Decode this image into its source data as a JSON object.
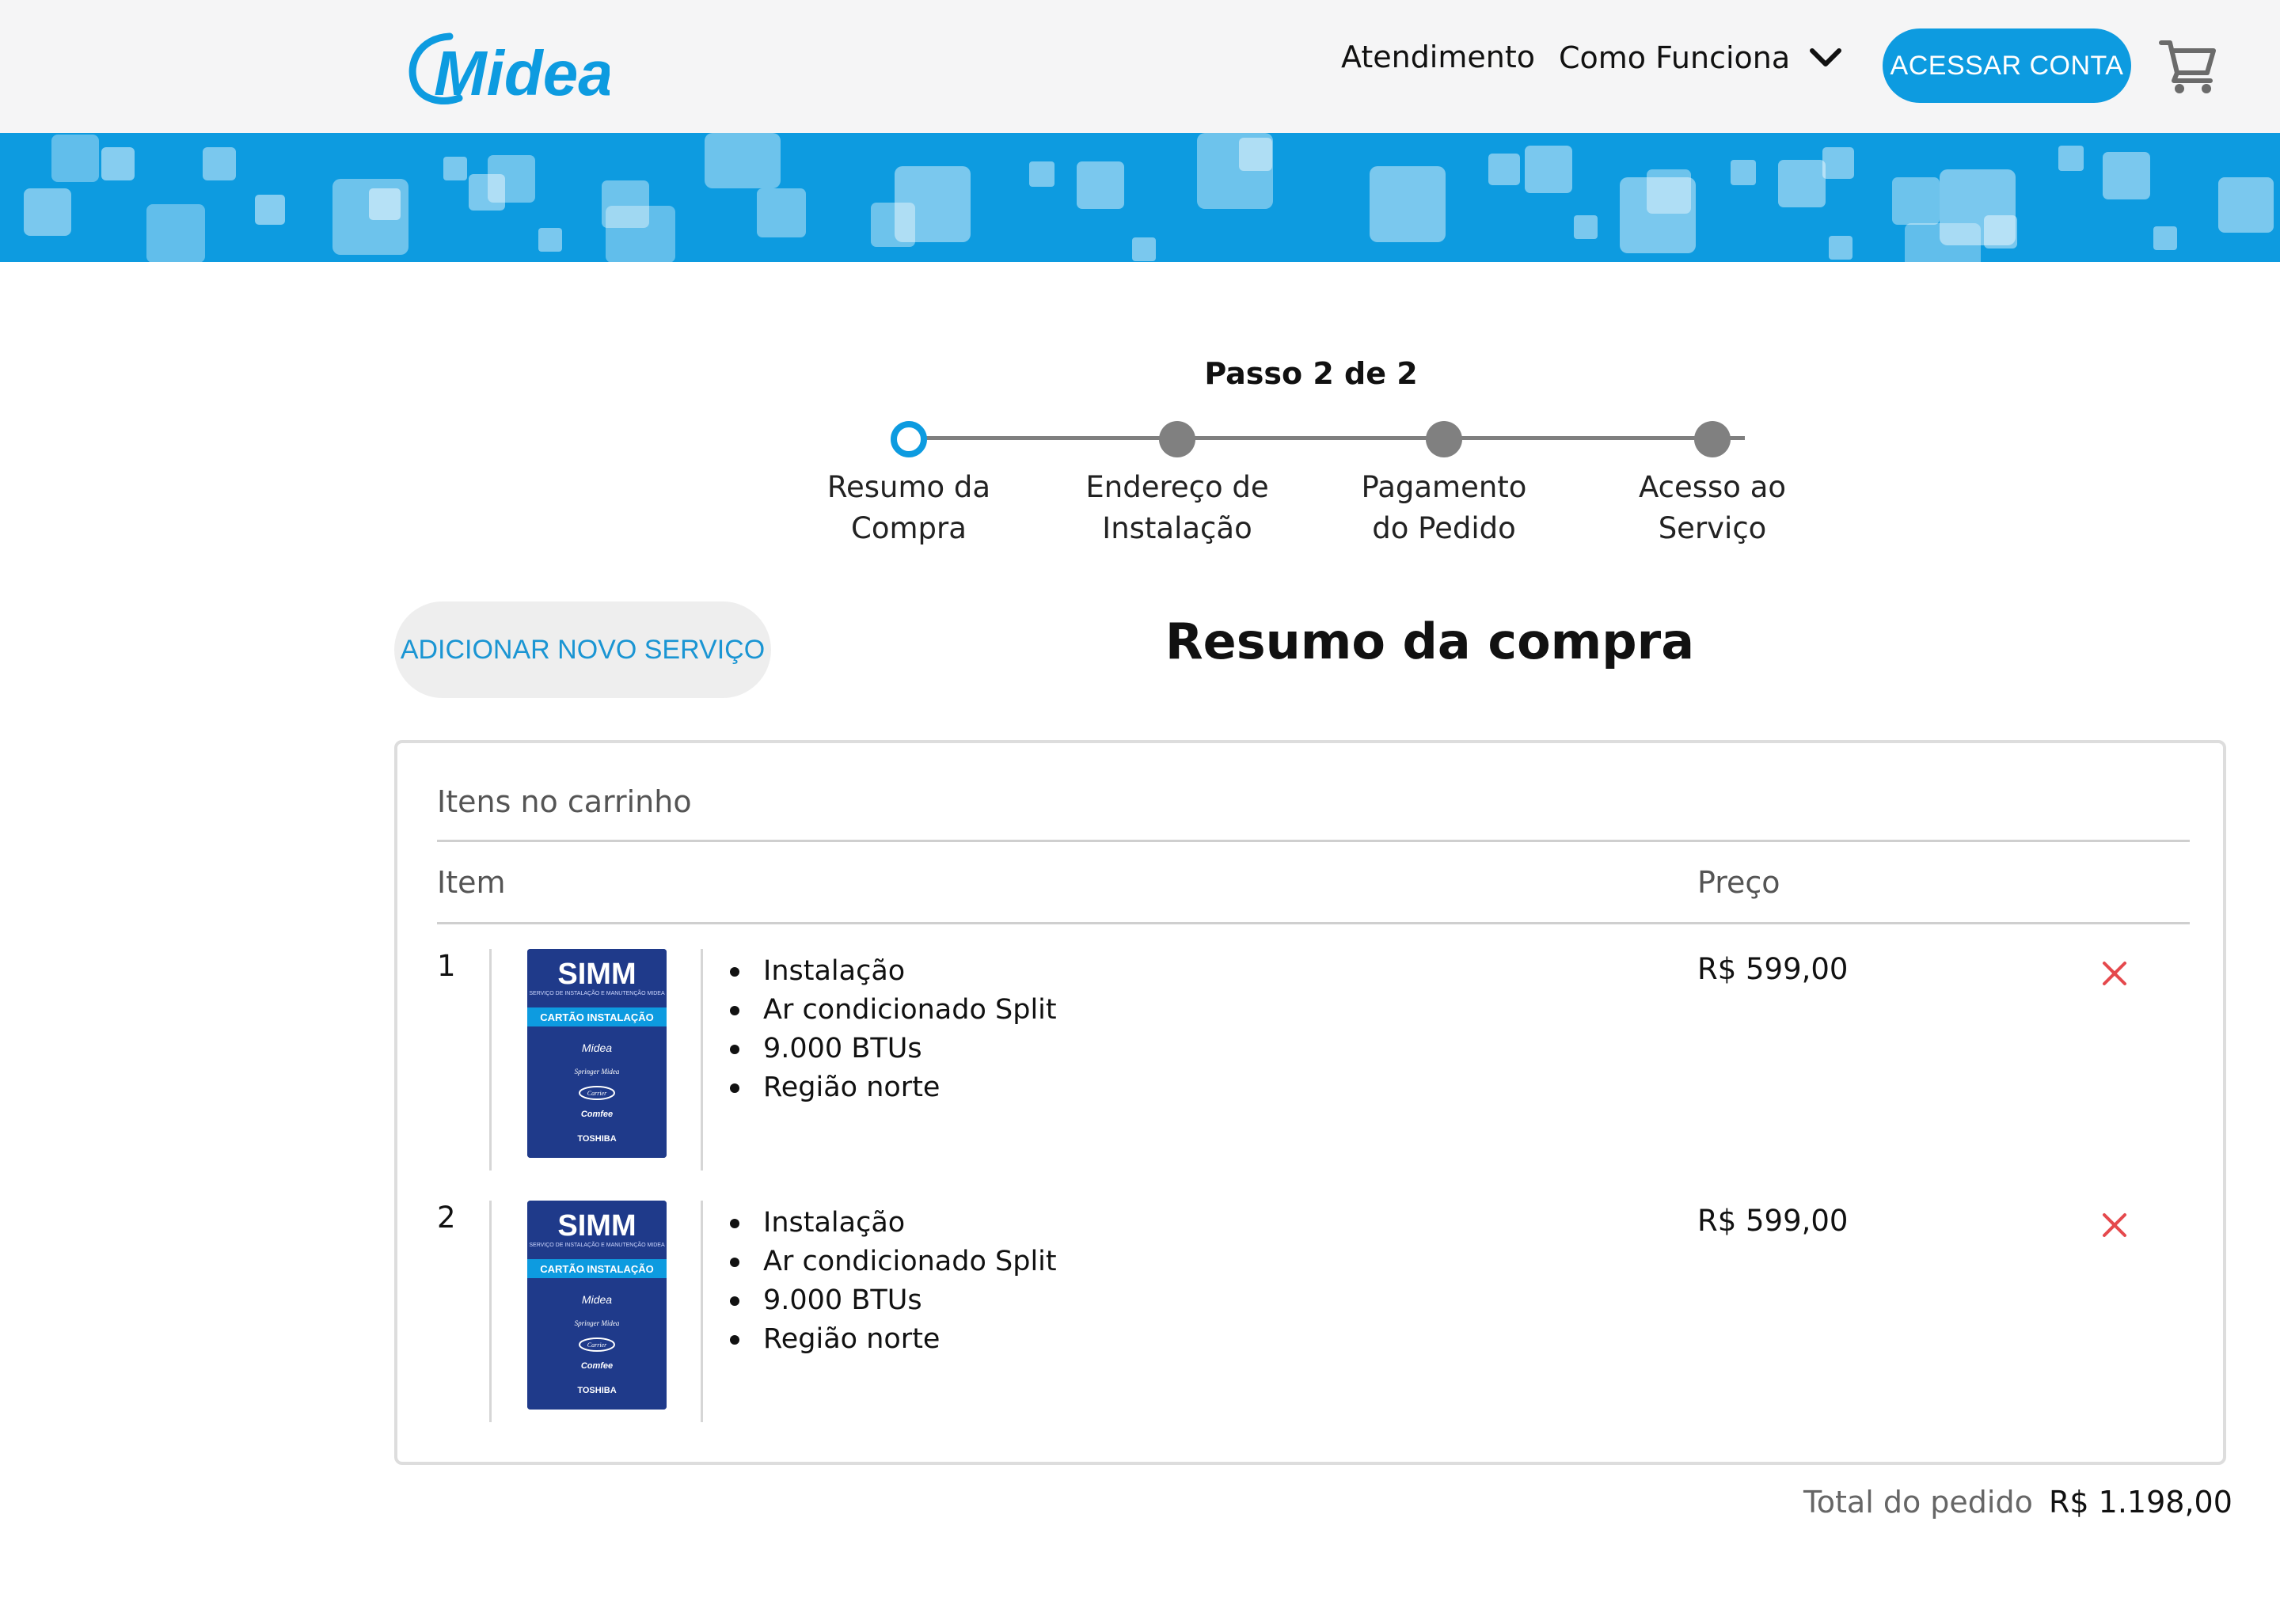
{
  "header": {
    "logo_text": "Midea",
    "nav": {
      "atendimento": "Atendimento",
      "como_funciona": "Como Funciona"
    },
    "login_button": "ACESSAR CONTA",
    "icons": [
      "chevron-down-icon",
      "cart-icon"
    ]
  },
  "colors": {
    "brand_blue": "#0d9be0",
    "header_bg": "#f5f5f6",
    "remove_red": "#e5494d",
    "step_inactive": "#808080",
    "product_card_navy": "#1f3a8a"
  },
  "stepper": {
    "caption": "Passo 2 de 2",
    "steps": [
      {
        "label": "Resumo da\nCompra",
        "active": true
      },
      {
        "label": "Endereço de\nInstalação",
        "active": false
      },
      {
        "label": "Pagamento\ndo Pedido",
        "active": false
      },
      {
        "label": "Acesso ao\nServiço",
        "active": false
      }
    ]
  },
  "add_service_button": "ADICIONAR NOVO SERVIÇO",
  "page_title": "Resumo da compra",
  "cart": {
    "title": "Itens no carrinho",
    "columns": {
      "item": "Item",
      "price": "Preço"
    },
    "items": [
      {
        "number": "1",
        "image": {
          "brand": "SIMM",
          "subtitle": "SERVIÇO DE INSTALAÇÃO E MANUTENÇÃO MIDEA",
          "band": "CARTÃO INSTALAÇÃO",
          "logos": [
            "Midea",
            "Springer Midea",
            "Carrier",
            "Comfee",
            "TOSHIBA"
          ]
        },
        "details": [
          "Instalação",
          "Ar condicionado Split",
          "9.000 BTUs",
          "Região norte"
        ],
        "price": "R$ 599,00"
      },
      {
        "number": "2",
        "image": {
          "brand": "SIMM",
          "subtitle": "SERVIÇO DE INSTALAÇÃO E MANUTENÇÃO MIDEA",
          "band": "CARTÃO INSTALAÇÃO",
          "logos": [
            "Midea",
            "Springer Midea",
            "Carrier",
            "Comfee",
            "TOSHIBA"
          ]
        },
        "details": [
          "Instalação",
          "Ar condicionado Split",
          "9.000 BTUs",
          "Região norte"
        ],
        "price": "R$ 599,00"
      }
    ]
  },
  "total": {
    "label": "Total do pedido",
    "value": "R$ 1.198,00"
  }
}
